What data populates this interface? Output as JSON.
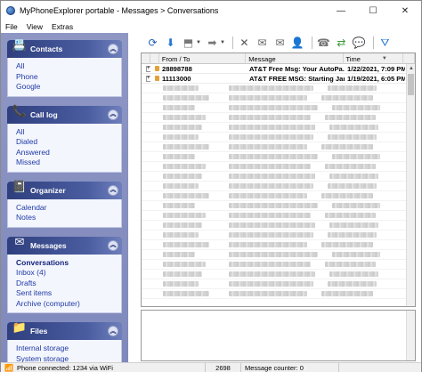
{
  "window": {
    "title": "MyPhoneExplorer portable - Messages > Conversations",
    "minimize": "—",
    "maximize": "☐",
    "close": "✕"
  },
  "menu": {
    "file": "File",
    "view": "View",
    "extras": "Extras"
  },
  "sidebar": {
    "contacts": {
      "title": "Contacts",
      "icon": "contacts-icon",
      "items": [
        "All",
        "Phone",
        "Google"
      ]
    },
    "calllog": {
      "title": "Call log",
      "icon": "phone-icon",
      "items": [
        "All",
        "Dialed",
        "Answered",
        "Missed"
      ]
    },
    "organizer": {
      "title": "Organizer",
      "icon": "organizer-icon",
      "items": [
        "Calendar",
        "Notes"
      ]
    },
    "messages": {
      "title": "Messages",
      "icon": "envelope-icon",
      "items": [
        "Conversations",
        "Inbox (4)",
        "Drafts",
        "Sent items",
        "Archive (computer)"
      ],
      "active": "Conversations"
    },
    "files": {
      "title": "Files",
      "icon": "folder-icon",
      "items": [
        "Internal storage",
        "System storage"
      ]
    },
    "collapse_glyph": "︽"
  },
  "grid": {
    "columns": {
      "from_to": "From / To",
      "message": "Message",
      "time": "Time"
    },
    "rows": [
      {
        "expander": "+",
        "from": "28898788",
        "message": "AT&T Free Msg: Your AutoPa...",
        "time": "1/22/2021, 7:09 PM"
      },
      {
        "expander": "+",
        "from": "11113000",
        "message": "AT&T FREE MSG: Starting Jan...",
        "time": "1/19/2021, 6:05 PM"
      }
    ],
    "blurred_rows": 22,
    "sort_glyph": "▼"
  },
  "status": {
    "connection": "Phone connected: 1234 via WiFi",
    "counter_label": "Message counter: 0",
    "count": "2698"
  },
  "colors": {
    "accent": "#2f3f7e",
    "sidebar_bg": "#8e97c4",
    "link": "#1f3aa6"
  }
}
